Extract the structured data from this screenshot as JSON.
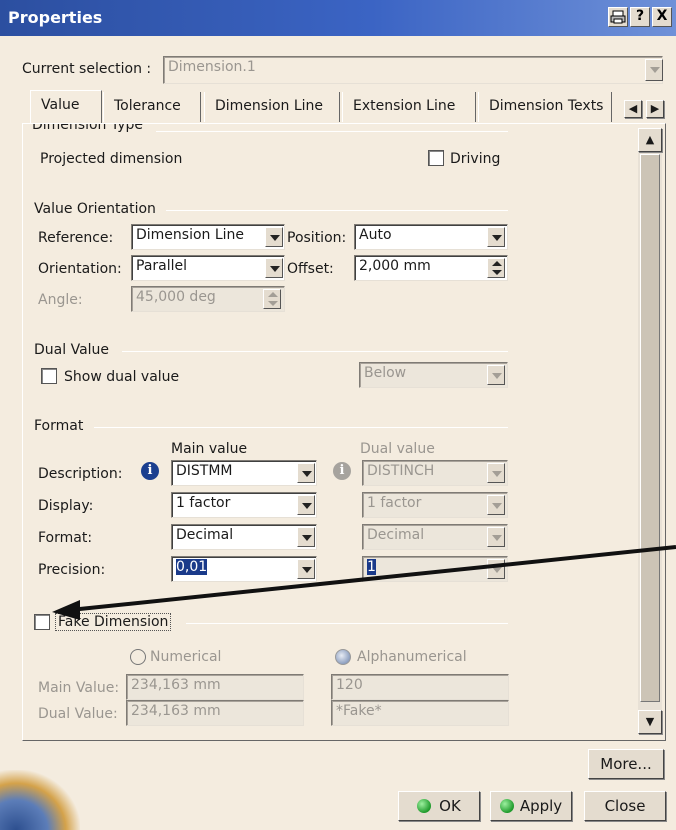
{
  "window": {
    "title": "Properties",
    "help_label": "?",
    "close_label": "X",
    "icons": [
      "print-icon",
      "help-icon",
      "close-icon"
    ]
  },
  "current_selection": {
    "label": "Current selection :",
    "value": "Dimension.1"
  },
  "tabs": [
    {
      "label": "Value",
      "active": true
    },
    {
      "label": "Tolerance"
    },
    {
      "label": "Dimension Line"
    },
    {
      "label": "Extension Line"
    },
    {
      "label": "Dimension Texts"
    }
  ],
  "dimension_type": {
    "title": "Dimension Type",
    "projected": "Projected dimension",
    "driving": "Driving"
  },
  "value_orientation": {
    "title": "Value Orientation",
    "reference_label": "Reference:",
    "reference_value": "Dimension Line",
    "position_label": "Position:",
    "position_value": "Auto",
    "orientation_label": "Orientation:",
    "orientation_value": "Parallel",
    "offset_label": "Offset:",
    "offset_value": "2,000 mm",
    "angle_label": "Angle:",
    "angle_value": "45,000 deg"
  },
  "dual_value": {
    "title": "Dual Value",
    "show_label": "Show dual value",
    "position_value": "Below"
  },
  "format": {
    "title": "Format",
    "main_header": "Main value",
    "dual_header": "Dual value",
    "rows": [
      {
        "label": "Description:",
        "main": "DISTMM",
        "dual": "DISTINCH"
      },
      {
        "label": "Display:",
        "main": "1 factor",
        "dual": "1 factor"
      },
      {
        "label": "Format:",
        "main": "Decimal",
        "dual": "Decimal"
      },
      {
        "label": "Precision:",
        "main": "0,01",
        "dual": "1"
      }
    ]
  },
  "fake_dimension": {
    "label": "Fake Dimension",
    "numerical": "Numerical",
    "alphanumerical": "Alphanumerical",
    "main_label": "Main Value:",
    "main_numeric": "234,163 mm",
    "main_alpha": "120",
    "dual_label": "Dual Value:",
    "dual_numeric": "234,163 mm",
    "dual_alpha": "*Fake*"
  },
  "buttons": {
    "more": "More...",
    "ok": "OK",
    "apply": "Apply",
    "close": "Close"
  },
  "colors": {
    "title_bar": "#2c4fa0",
    "ok_icon": "#1f9a2c",
    "info_icon": "#1b3f8f",
    "selection": "#1a3a8a"
  }
}
